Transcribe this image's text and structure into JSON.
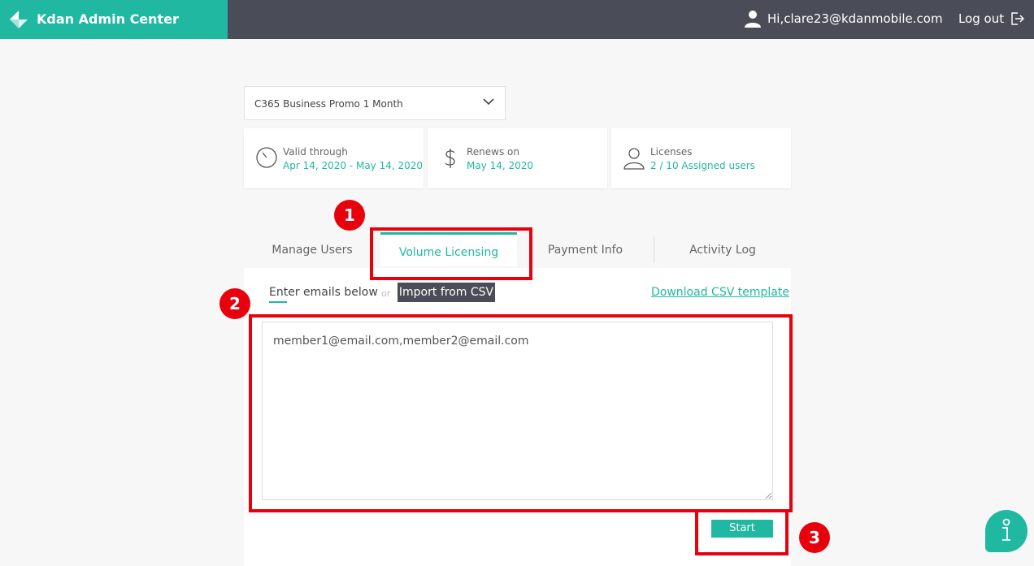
{
  "header": {
    "brand_title": "Kdan Admin Center",
    "user_text": "Hi,clare23@kdanmobile.com",
    "logout_label": "Log out"
  },
  "plan": {
    "selected": "C365 Business Promo 1 Month"
  },
  "cards": [
    {
      "icon": "timer-icon",
      "label": "Valid through",
      "value": "Apr 14, 2020 - May 14, 2020"
    },
    {
      "icon": "dollar-icon",
      "label": "Renews on",
      "value": "May 14, 2020"
    },
    {
      "icon": "user-icon",
      "label": "Licenses",
      "value": "2 / 10 Assigned users"
    }
  ],
  "tabs": [
    {
      "label": "Manage Users",
      "active": false
    },
    {
      "label": "Volume Licensing",
      "active": true
    },
    {
      "label": "Payment Info",
      "active": false
    },
    {
      "label": "Activity Log",
      "active": false
    }
  ],
  "panel": {
    "enter_emails_label": "Enter emails below",
    "or_label": "or",
    "import_label": "Import from CSV",
    "download_label": "Download CSV template",
    "emails_value": "member1@email.com,member2@email.com",
    "start_label": "Start"
  },
  "annotations": [
    "1",
    "2",
    "3"
  ],
  "colors": {
    "accent": "#20b8a0",
    "header_bg": "#4a4d57",
    "highlight": "#e8000c"
  }
}
